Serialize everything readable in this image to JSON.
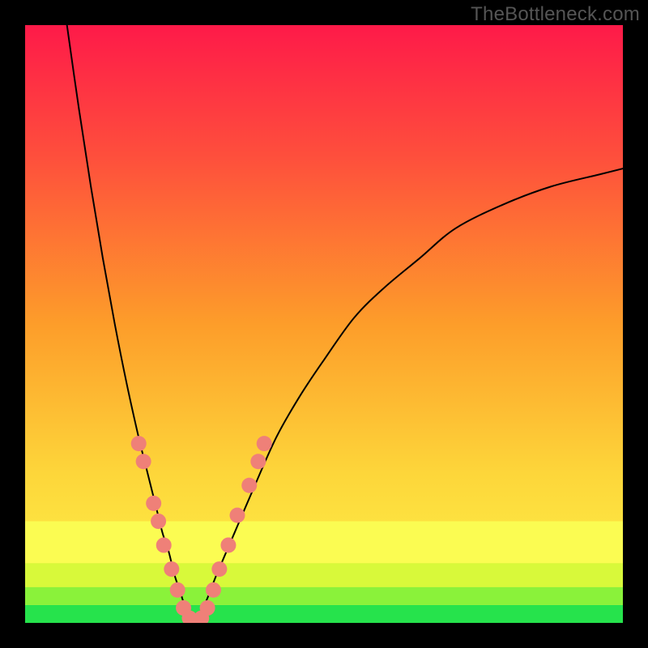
{
  "watermark": "TheBottleneck.com",
  "chart_data": {
    "type": "line",
    "title": "",
    "xlabel": "",
    "ylabel": "",
    "xlim": [
      0,
      100
    ],
    "ylim": [
      0,
      100
    ],
    "series": [
      {
        "name": "left-branch",
        "x": [
          7,
          9,
          11,
          13,
          15,
          17,
          19,
          20,
          21,
          22,
          23,
          24,
          25,
          26,
          27,
          28
        ],
        "values": [
          100,
          86,
          73,
          61,
          50,
          40,
          31,
          27,
          23,
          19,
          15,
          12,
          8,
          5,
          2,
          0
        ]
      },
      {
        "name": "right-branch",
        "x": [
          28,
          30,
          32,
          35,
          38,
          42,
          46,
          50,
          55,
          60,
          66,
          72,
          80,
          88,
          96,
          100
        ],
        "values": [
          0,
          3,
          8,
          15,
          22,
          31,
          38,
          44,
          51,
          56,
          61,
          66,
          70,
          73,
          75,
          76
        ]
      }
    ],
    "dots": {
      "name": "highlight-points",
      "color": "#ef8078",
      "points": [
        {
          "x": 19.0,
          "y": 30
        },
        {
          "x": 19.8,
          "y": 27
        },
        {
          "x": 21.5,
          "y": 20
        },
        {
          "x": 22.3,
          "y": 17
        },
        {
          "x": 23.2,
          "y": 13
        },
        {
          "x": 24.5,
          "y": 9
        },
        {
          "x": 25.5,
          "y": 5.5
        },
        {
          "x": 26.5,
          "y": 2.5
        },
        {
          "x": 27.5,
          "y": 0.8
        },
        {
          "x": 28.5,
          "y": 0.2
        },
        {
          "x": 29.5,
          "y": 0.8
        },
        {
          "x": 30.5,
          "y": 2.5
        },
        {
          "x": 31.5,
          "y": 5.5
        },
        {
          "x": 32.5,
          "y": 9
        },
        {
          "x": 34.0,
          "y": 13
        },
        {
          "x": 35.5,
          "y": 18
        },
        {
          "x": 37.5,
          "y": 23
        },
        {
          "x": 39.0,
          "y": 27
        },
        {
          "x": 40.0,
          "y": 30
        }
      ]
    },
    "bands": [
      {
        "name": "green-band",
        "from": 0,
        "to": 3,
        "color": "#26e34c"
      },
      {
        "name": "lime-band",
        "from": 3,
        "to": 6,
        "color": "#8af23a"
      },
      {
        "name": "chart-band",
        "from": 6,
        "to": 10,
        "color": "#d8f93a"
      },
      {
        "name": "lemon-band",
        "from": 10,
        "to": 17,
        "color": "#fbfc52"
      }
    ],
    "gradient": {
      "top": "#fe1a49",
      "mid": "#fd9d2a",
      "bottom": "#fcf94b"
    }
  }
}
